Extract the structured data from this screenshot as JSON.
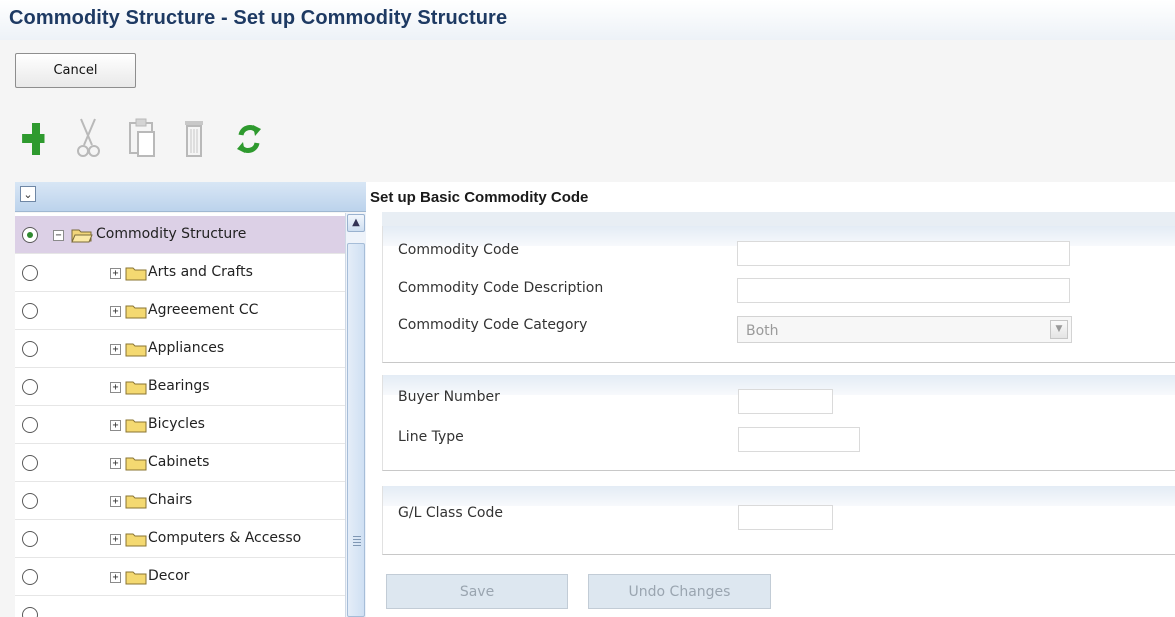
{
  "page": {
    "title": "Commodity Structure - Set up Commodity Structure"
  },
  "actions": {
    "cancel_label": "Cancel"
  },
  "toolbar": {
    "icons": [
      "add-icon",
      "cut-icon",
      "paste-icon",
      "delete-icon",
      "refresh-icon"
    ]
  },
  "tree": {
    "root_label": "Commodity Structure",
    "items": [
      {
        "label": "Arts and Crafts"
      },
      {
        "label": "Agreeement CC"
      },
      {
        "label": "Appliances"
      },
      {
        "label": "Bearings"
      },
      {
        "label": "Bicycles"
      },
      {
        "label": "Cabinets"
      },
      {
        "label": "Chairs"
      },
      {
        "label": "Computers & Accesso"
      },
      {
        "label": "Decor"
      }
    ]
  },
  "form": {
    "title": "Set up Basic Commodity Code",
    "commodity_code_label": "Commodity Code",
    "commodity_code_value": "",
    "description_label": "Commodity Code Description",
    "description_value": "",
    "category_label": "Commodity Code Category",
    "category_value": "Both",
    "buyer_number_label": "Buyer Number",
    "buyer_number_value": "",
    "line_type_label": "Line Type",
    "line_type_value": "",
    "gl_class_label": "G/L Class Code",
    "gl_class_value": "",
    "save_label": "Save",
    "undo_label": "Undo Changes"
  },
  "colors": {
    "title_text": "#1e3a63",
    "add_icon": "#2e9a2e",
    "refresh_icon": "#2e9a2e",
    "selected_row": "#dcd0e6"
  }
}
